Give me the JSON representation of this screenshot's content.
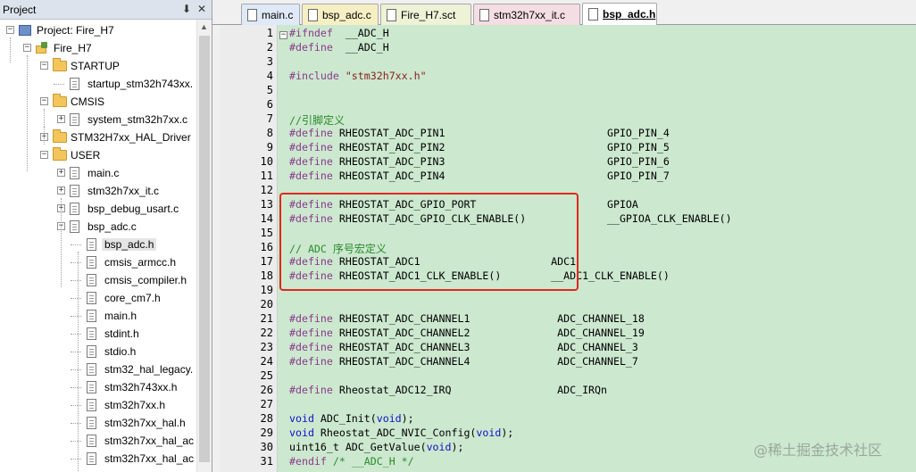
{
  "project_pane": {
    "title": "Project",
    "pin_icon": "pin-icon",
    "close_icon": "close-icon",
    "tree": [
      {
        "label": "Project: Fire_H7",
        "icon": "project-icon",
        "toggle": "-",
        "level": 0
      },
      {
        "label": "Fire_H7",
        "icon": "target-icon",
        "toggle": "-",
        "level": 1
      },
      {
        "label": "STARTUP",
        "icon": "folder-icon",
        "toggle": "-",
        "level": 2
      },
      {
        "label": "startup_stm32h743xx.",
        "icon": "file-icon",
        "toggle": "",
        "level": 3
      },
      {
        "label": "CMSIS",
        "icon": "folder-icon",
        "toggle": "-",
        "level": 2
      },
      {
        "label": "system_stm32h7xx.c",
        "icon": "file-icon",
        "toggle": "+",
        "level": 3
      },
      {
        "label": "STM32H7xx_HAL_Driver",
        "icon": "folder-icon",
        "toggle": "+",
        "level": 2
      },
      {
        "label": "USER",
        "icon": "folder-icon",
        "toggle": "-",
        "level": 2
      },
      {
        "label": "main.c",
        "icon": "file-icon",
        "toggle": "+",
        "level": 3
      },
      {
        "label": "stm32h7xx_it.c",
        "icon": "file-icon",
        "toggle": "+",
        "level": 3
      },
      {
        "label": "bsp_debug_usart.c",
        "icon": "file-icon",
        "toggle": "+",
        "level": 3
      },
      {
        "label": "bsp_adc.c",
        "icon": "file-icon",
        "toggle": "-",
        "level": 3
      },
      {
        "label": "bsp_adc.h",
        "icon": "file-icon",
        "toggle": "",
        "level": 4,
        "selected": true
      },
      {
        "label": "cmsis_armcc.h",
        "icon": "file-icon",
        "toggle": "",
        "level": 4
      },
      {
        "label": "cmsis_compiler.h",
        "icon": "file-icon",
        "toggle": "",
        "level": 4
      },
      {
        "label": "core_cm7.h",
        "icon": "file-icon",
        "toggle": "",
        "level": 4
      },
      {
        "label": "main.h",
        "icon": "file-icon",
        "toggle": "",
        "level": 4
      },
      {
        "label": "stdint.h",
        "icon": "file-icon",
        "toggle": "",
        "level": 4
      },
      {
        "label": "stdio.h",
        "icon": "file-icon",
        "toggle": "",
        "level": 4
      },
      {
        "label": "stm32_hal_legacy.",
        "icon": "file-icon",
        "toggle": "",
        "level": 4
      },
      {
        "label": "stm32h743xx.h",
        "icon": "file-icon",
        "toggle": "",
        "level": 4
      },
      {
        "label": "stm32h7xx.h",
        "icon": "file-icon",
        "toggle": "",
        "level": 4
      },
      {
        "label": "stm32h7xx_hal.h",
        "icon": "file-icon",
        "toggle": "",
        "level": 4
      },
      {
        "label": "stm32h7xx_hal_ac",
        "icon": "file-icon",
        "toggle": "",
        "level": 4
      },
      {
        "label": "stm32h7xx_hal_ac",
        "icon": "file-icon",
        "toggle": "",
        "level": 4
      }
    ]
  },
  "editor": {
    "tabs": [
      {
        "label": "main.c",
        "color": "#dfe9f7",
        "active": false
      },
      {
        "label": "bsp_adc.c",
        "color": "#f7efc4",
        "active": false
      },
      {
        "label": "Fire_H7.sct",
        "color": "#eef2d6",
        "active": false
      },
      {
        "label": "stm32h7xx_it.c",
        "color": "#f5dde4",
        "active": false
      },
      {
        "label": "bsp_adc.h",
        "color": "#ffffff",
        "active": true
      }
    ],
    "code_background": "#cce8cf",
    "highlight_color": "#e0281e",
    "lines": [
      {
        "n": "1",
        "parts": [
          [
            "pp",
            "#ifndef"
          ],
          [
            "",
            "  __ADC_H"
          ]
        ]
      },
      {
        "n": "2",
        "parts": [
          [
            "pp",
            "#define"
          ],
          [
            "",
            "  __ADC_H"
          ]
        ]
      },
      {
        "n": "3",
        "parts": []
      },
      {
        "n": "4",
        "parts": [
          [
            "pp",
            "#include"
          ],
          [
            "",
            " "
          ],
          [
            "str",
            "\"stm32h7xx.h\""
          ]
        ]
      },
      {
        "n": "5",
        "parts": []
      },
      {
        "n": "6",
        "parts": []
      },
      {
        "n": "7",
        "parts": [
          [
            "cmt",
            "//"
          ],
          [
            "cmt zh",
            "引脚定义"
          ]
        ]
      },
      {
        "n": "8",
        "parts": [
          [
            "pp",
            "#define"
          ],
          [
            "",
            " RHEOSTAT_ADC_PIN1                          GPIO_PIN_4"
          ]
        ]
      },
      {
        "n": "9",
        "parts": [
          [
            "pp",
            "#define"
          ],
          [
            "",
            " RHEOSTAT_ADC_PIN2                          GPIO_PIN_5"
          ]
        ]
      },
      {
        "n": "10",
        "parts": [
          [
            "pp",
            "#define"
          ],
          [
            "",
            " RHEOSTAT_ADC_PIN3                          GPIO_PIN_6"
          ]
        ]
      },
      {
        "n": "11",
        "parts": [
          [
            "pp",
            "#define"
          ],
          [
            "",
            " RHEOSTAT_ADC_PIN4                          GPIO_PIN_7"
          ]
        ]
      },
      {
        "n": "12",
        "parts": []
      },
      {
        "n": "13",
        "parts": [
          [
            "pp",
            "#define"
          ],
          [
            "",
            " RHEOSTAT_ADC_GPIO_PORT                     GPIOA"
          ]
        ]
      },
      {
        "n": "14",
        "parts": [
          [
            "pp",
            "#define"
          ],
          [
            "",
            " RHEOSTAT_ADC_GPIO_CLK_ENABLE()             __GPIOA_CLK_ENABLE()"
          ]
        ]
      },
      {
        "n": "15",
        "parts": []
      },
      {
        "n": "16",
        "parts": [
          [
            "cmt",
            "// ADC "
          ],
          [
            "cmt zh",
            "序号宏定义"
          ]
        ]
      },
      {
        "n": "17",
        "parts": [
          [
            "pp",
            "#define"
          ],
          [
            "",
            " RHEOSTAT_ADC1                     ADC1"
          ]
        ]
      },
      {
        "n": "18",
        "parts": [
          [
            "pp",
            "#define"
          ],
          [
            "",
            " RHEOSTAT_ADC1_CLK_ENABLE()        __ADC1_CLK_ENABLE()"
          ]
        ]
      },
      {
        "n": "19",
        "parts": []
      },
      {
        "n": "20",
        "parts": []
      },
      {
        "n": "21",
        "parts": [
          [
            "pp",
            "#define"
          ],
          [
            "",
            " RHEOSTAT_ADC_CHANNEL1              ADC_CHANNEL_18"
          ]
        ]
      },
      {
        "n": "22",
        "parts": [
          [
            "pp",
            "#define"
          ],
          [
            "",
            " RHEOSTAT_ADC_CHANNEL2              ADC_CHANNEL_19"
          ]
        ]
      },
      {
        "n": "23",
        "parts": [
          [
            "pp",
            "#define"
          ],
          [
            "",
            " RHEOSTAT_ADC_CHANNEL3              ADC_CHANNEL_3"
          ]
        ]
      },
      {
        "n": "24",
        "parts": [
          [
            "pp",
            "#define"
          ],
          [
            "",
            " RHEOSTAT_ADC_CHANNEL4              ADC_CHANNEL_7"
          ]
        ]
      },
      {
        "n": "25",
        "parts": []
      },
      {
        "n": "26",
        "parts": [
          [
            "pp",
            "#define"
          ],
          [
            "",
            " Rheostat_ADC12_IRQ                 ADC_IRQn"
          ]
        ]
      },
      {
        "n": "27",
        "parts": []
      },
      {
        "n": "28",
        "parts": [
          [
            "kw",
            "void"
          ],
          [
            "",
            " ADC_Init("
          ],
          [
            "kw",
            "void"
          ],
          [
            "",
            ");"
          ]
        ]
      },
      {
        "n": "29",
        "parts": [
          [
            "kw",
            "void"
          ],
          [
            "",
            " Rheostat_ADC_NVIC_Config("
          ],
          [
            "kw",
            "void"
          ],
          [
            "",
            ");"
          ]
        ]
      },
      {
        "n": "30",
        "parts": [
          [
            "",
            "uint16_t ADC_GetValue("
          ],
          [
            "kw",
            "void"
          ],
          [
            "",
            ");"
          ]
        ]
      },
      {
        "n": "31",
        "parts": [
          [
            "pp",
            "#endif"
          ],
          [
            "",
            " "
          ],
          [
            "cmt",
            "/* __ADC_H */"
          ]
        ]
      }
    ]
  },
  "watermark": "@稀土掘金技术社区"
}
